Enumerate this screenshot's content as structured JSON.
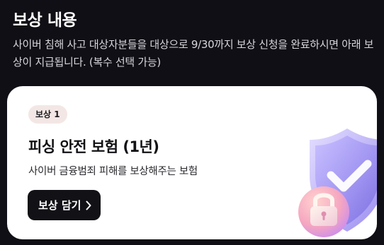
{
  "section": {
    "title": "보상 내용",
    "description": "사이버 침해 사고 대상자분들을 대상으로 9/30까지 보상 신청을 완료하시면 아래 보상이 지급됩니다. (복수 선택 가능)"
  },
  "reward": {
    "badge": "보상 1",
    "title": "피싱 안전 보험 (1년)",
    "description": "사이버 금융범죄 피해를 보상해주는 보험",
    "button_label": "보상 담기",
    "illustration_icons": [
      "shield-check-icon",
      "padlock-icon"
    ]
  },
  "colors": {
    "background": "#0f0f15",
    "card": "#ffffff",
    "badge_bg": "#f3e7e5",
    "button_bg": "#121216",
    "shield": "#a99cf5",
    "lock": "#f3a6b8"
  }
}
